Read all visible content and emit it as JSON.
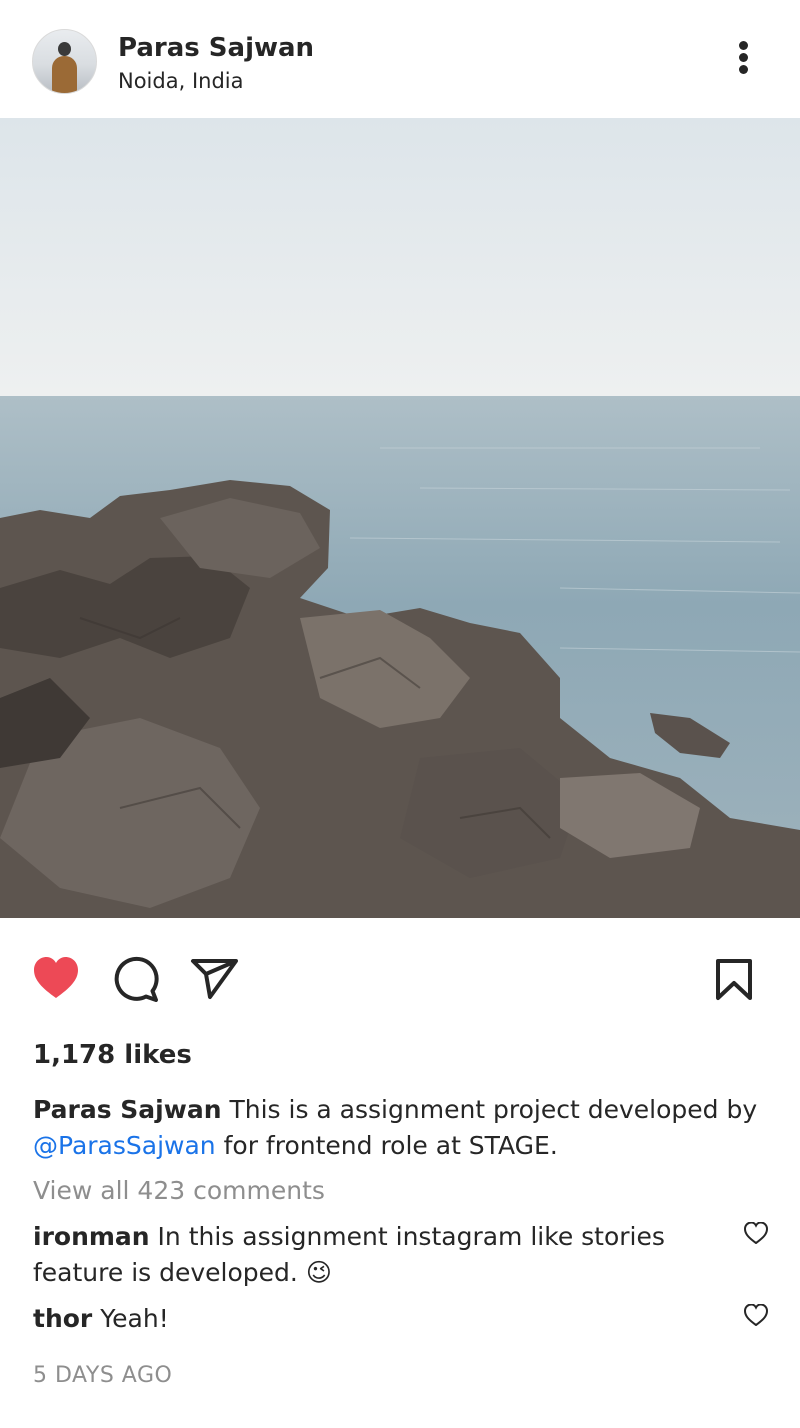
{
  "post": {
    "username": "Paras Sajwan",
    "location": "Noida, India",
    "likes": "1,178 likes",
    "caption": {
      "author": "Paras Sajwan",
      "text_before": "This is a assignment project developed by",
      "mention": "@ParasSajwan",
      "text_after": "for frontend role at STAGE."
    },
    "view_all_comments": "View all 423 comments",
    "comments": [
      {
        "user": "ironman",
        "text": "In this assignment instagram like stories feature is developed.",
        "emoji": "😉"
      },
      {
        "user": "thor",
        "text": "Yeah!"
      }
    ],
    "timestamp": "5 DAYS AGO"
  },
  "icons": {
    "more": "more-vertical-icon",
    "like": "heart-filled-icon",
    "comment": "speech-bubble-icon",
    "share": "paper-plane-icon",
    "save": "bookmark-icon",
    "comment_like": "heart-outline-icon"
  },
  "colors": {
    "like_red": "#ed4956",
    "mention_blue": "#1a73e8",
    "muted_text": "#8e8e8e",
    "text": "#262626"
  }
}
